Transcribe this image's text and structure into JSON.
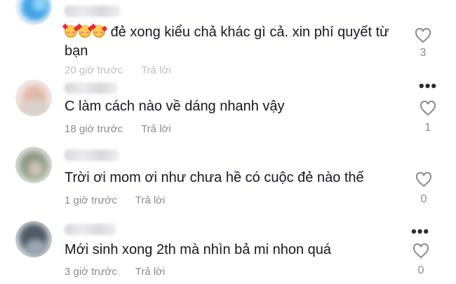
{
  "comments": [
    {
      "emoji": [
        "smiling-face-with-hearts-icon",
        "smiling-face-with-hearts-icon",
        "smiling-face-with-hearts-icon"
      ],
      "text_line1": "đẻ xong kiểu chả khác gì cả. xin phí quyết từ",
      "text_line2": "bạn",
      "time": "20 giờ trước",
      "reply": "Trả lời",
      "likes": "3"
    },
    {
      "text": "C làm cách nào về dáng nhanh vậy",
      "time": "18 giờ trước",
      "reply": "Trả lời",
      "likes": "1"
    },
    {
      "text": "Trời ơi mom ơi như chưa hề có cuộc đẻ nào thế",
      "time": "1 giờ trước",
      "reply": "Trả lời",
      "likes": "0"
    },
    {
      "text": "Mới sinh xong 2th mà nhìn bả mi nhon quá",
      "time": "3 giờ trước",
      "reply": "Trả lời",
      "likes": "0"
    }
  ],
  "icons": {
    "like": "heart-outline-icon",
    "more": "more-options-icon"
  },
  "colors": {
    "text": "#161823",
    "muted": "#8a8b91"
  }
}
